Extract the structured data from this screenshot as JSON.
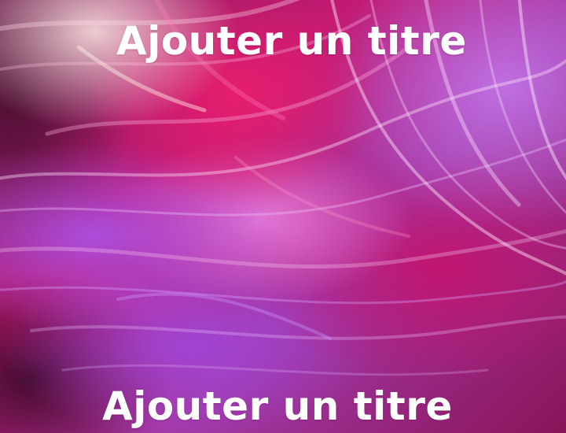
{
  "canvas": {
    "title_top": "Ajouter un titre",
    "title_bottom": "Ajouter un titre"
  },
  "background": {
    "description_colors": [
      "#c21a72",
      "#a23aa8",
      "#e81e6e",
      "#f58ce6",
      "#3a0a22"
    ]
  }
}
